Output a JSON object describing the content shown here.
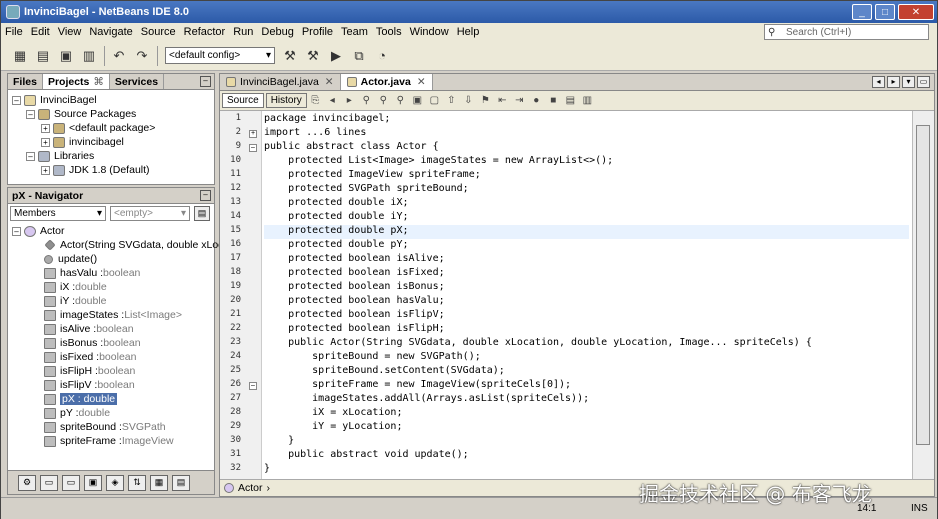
{
  "window": {
    "title": "InvinciBagel - NetBeans IDE 8.0",
    "min": "_",
    "max": "□",
    "close": "✕"
  },
  "menu": [
    "File",
    "Edit",
    "View",
    "Navigate",
    "Source",
    "Refactor",
    "Run",
    "Debug",
    "Profile",
    "Team",
    "Tools",
    "Window",
    "Help"
  ],
  "search": {
    "placeholder": "Search (Ctrl+I)"
  },
  "toolbar": {
    "config": "<default config>"
  },
  "projects_panel": {
    "tabs": [
      {
        "label": "Files"
      },
      {
        "label": "Projects"
      },
      {
        "label": "Services"
      }
    ],
    "tree": [
      {
        "label": "InvinciBagel"
      },
      {
        "label": "Source Packages"
      },
      {
        "label": "<default package>"
      },
      {
        "label": "invincibagel"
      },
      {
        "label": "Libraries"
      },
      {
        "label": "JDK 1.8 (Default)"
      }
    ]
  },
  "navigator": {
    "title": "pX - Navigator",
    "filter": "Members",
    "context": "<empty>",
    "root": "Actor",
    "members": [
      {
        "name": "Actor(String SVGdata, double xLocation, ",
        "type": ""
      },
      {
        "name": "update()",
        "type": ""
      },
      {
        "name": "hasValu : ",
        "type": "boolean"
      },
      {
        "name": "iX : ",
        "type": "double"
      },
      {
        "name": "iY : ",
        "type": "double"
      },
      {
        "name": "imageStates : ",
        "type": "List<Image>"
      },
      {
        "name": "isAlive : ",
        "type": "boolean"
      },
      {
        "name": "isBonus : ",
        "type": "boolean"
      },
      {
        "name": "isFixed : ",
        "type": "boolean"
      },
      {
        "name": "isFlipH : ",
        "type": "boolean"
      },
      {
        "name": "isFlipV : ",
        "type": "boolean"
      },
      {
        "name": "pX : double",
        "type": ""
      },
      {
        "name": "pY : ",
        "type": "double"
      },
      {
        "name": "spriteBound : ",
        "type": "SVGPath"
      },
      {
        "name": "spriteFrame : ",
        "type": "ImageView"
      }
    ]
  },
  "editor": {
    "tabs": [
      {
        "label": "InvinciBagel.java"
      },
      {
        "label": "Actor.java"
      }
    ],
    "source_label": "Source",
    "history_label": "History",
    "lines": [
      {
        "n": "1",
        "text": "package invincibagel;"
      },
      {
        "n": "2",
        "text": "import ...6 lines"
      },
      {
        "n": "9",
        "text": "public abstract class Actor {"
      },
      {
        "n": "10",
        "text": "    protected List<Image> imageStates = new ArrayList<>();"
      },
      {
        "n": "11",
        "text": "    protected ImageView spriteFrame;"
      },
      {
        "n": "12",
        "text": "    protected SVGPath spriteBound;"
      },
      {
        "n": "13",
        "text": "    protected double iX;"
      },
      {
        "n": "14",
        "text": "    protected double iY;"
      },
      {
        "n": "15",
        "text": "    protected double pX;"
      },
      {
        "n": "16",
        "text": "    protected double pY;"
      },
      {
        "n": "17",
        "text": "    protected boolean isAlive;"
      },
      {
        "n": "18",
        "text": "    protected boolean isFixed;"
      },
      {
        "n": "19",
        "text": "    protected boolean isBonus;"
      },
      {
        "n": "20",
        "text": "    protected boolean hasValu;"
      },
      {
        "n": "21",
        "text": "    protected boolean isFlipV;"
      },
      {
        "n": "22",
        "text": "    protected boolean isFlipH;"
      },
      {
        "n": "23",
        "text": "    public Actor(String SVGdata, double xLocation, double yLocation, Image... spriteCels) {"
      },
      {
        "n": "24",
        "text": "        spriteBound = new SVGPath();"
      },
      {
        "n": "25",
        "text": "        spriteBound.setContent(SVGdata);"
      },
      {
        "n": "26",
        "text": "        spriteFrame = new ImageView(spriteCels[0]);"
      },
      {
        "n": "27",
        "text": "        imageStates.addAll(Arrays.asList(spriteCels));"
      },
      {
        "n": "28",
        "text": "        iX = xLocation;"
      },
      {
        "n": "29",
        "text": "        iY = yLocation;"
      },
      {
        "n": "30",
        "text": "    }"
      },
      {
        "n": "31",
        "text": "    public abstract void update();"
      },
      {
        "n": "32",
        "text": "}"
      }
    ],
    "breadcrumb": "Actor"
  },
  "status": {
    "position": "14:1",
    "mode": "INS"
  },
  "watermark": "掘金技术社区 @ 布客飞龙"
}
